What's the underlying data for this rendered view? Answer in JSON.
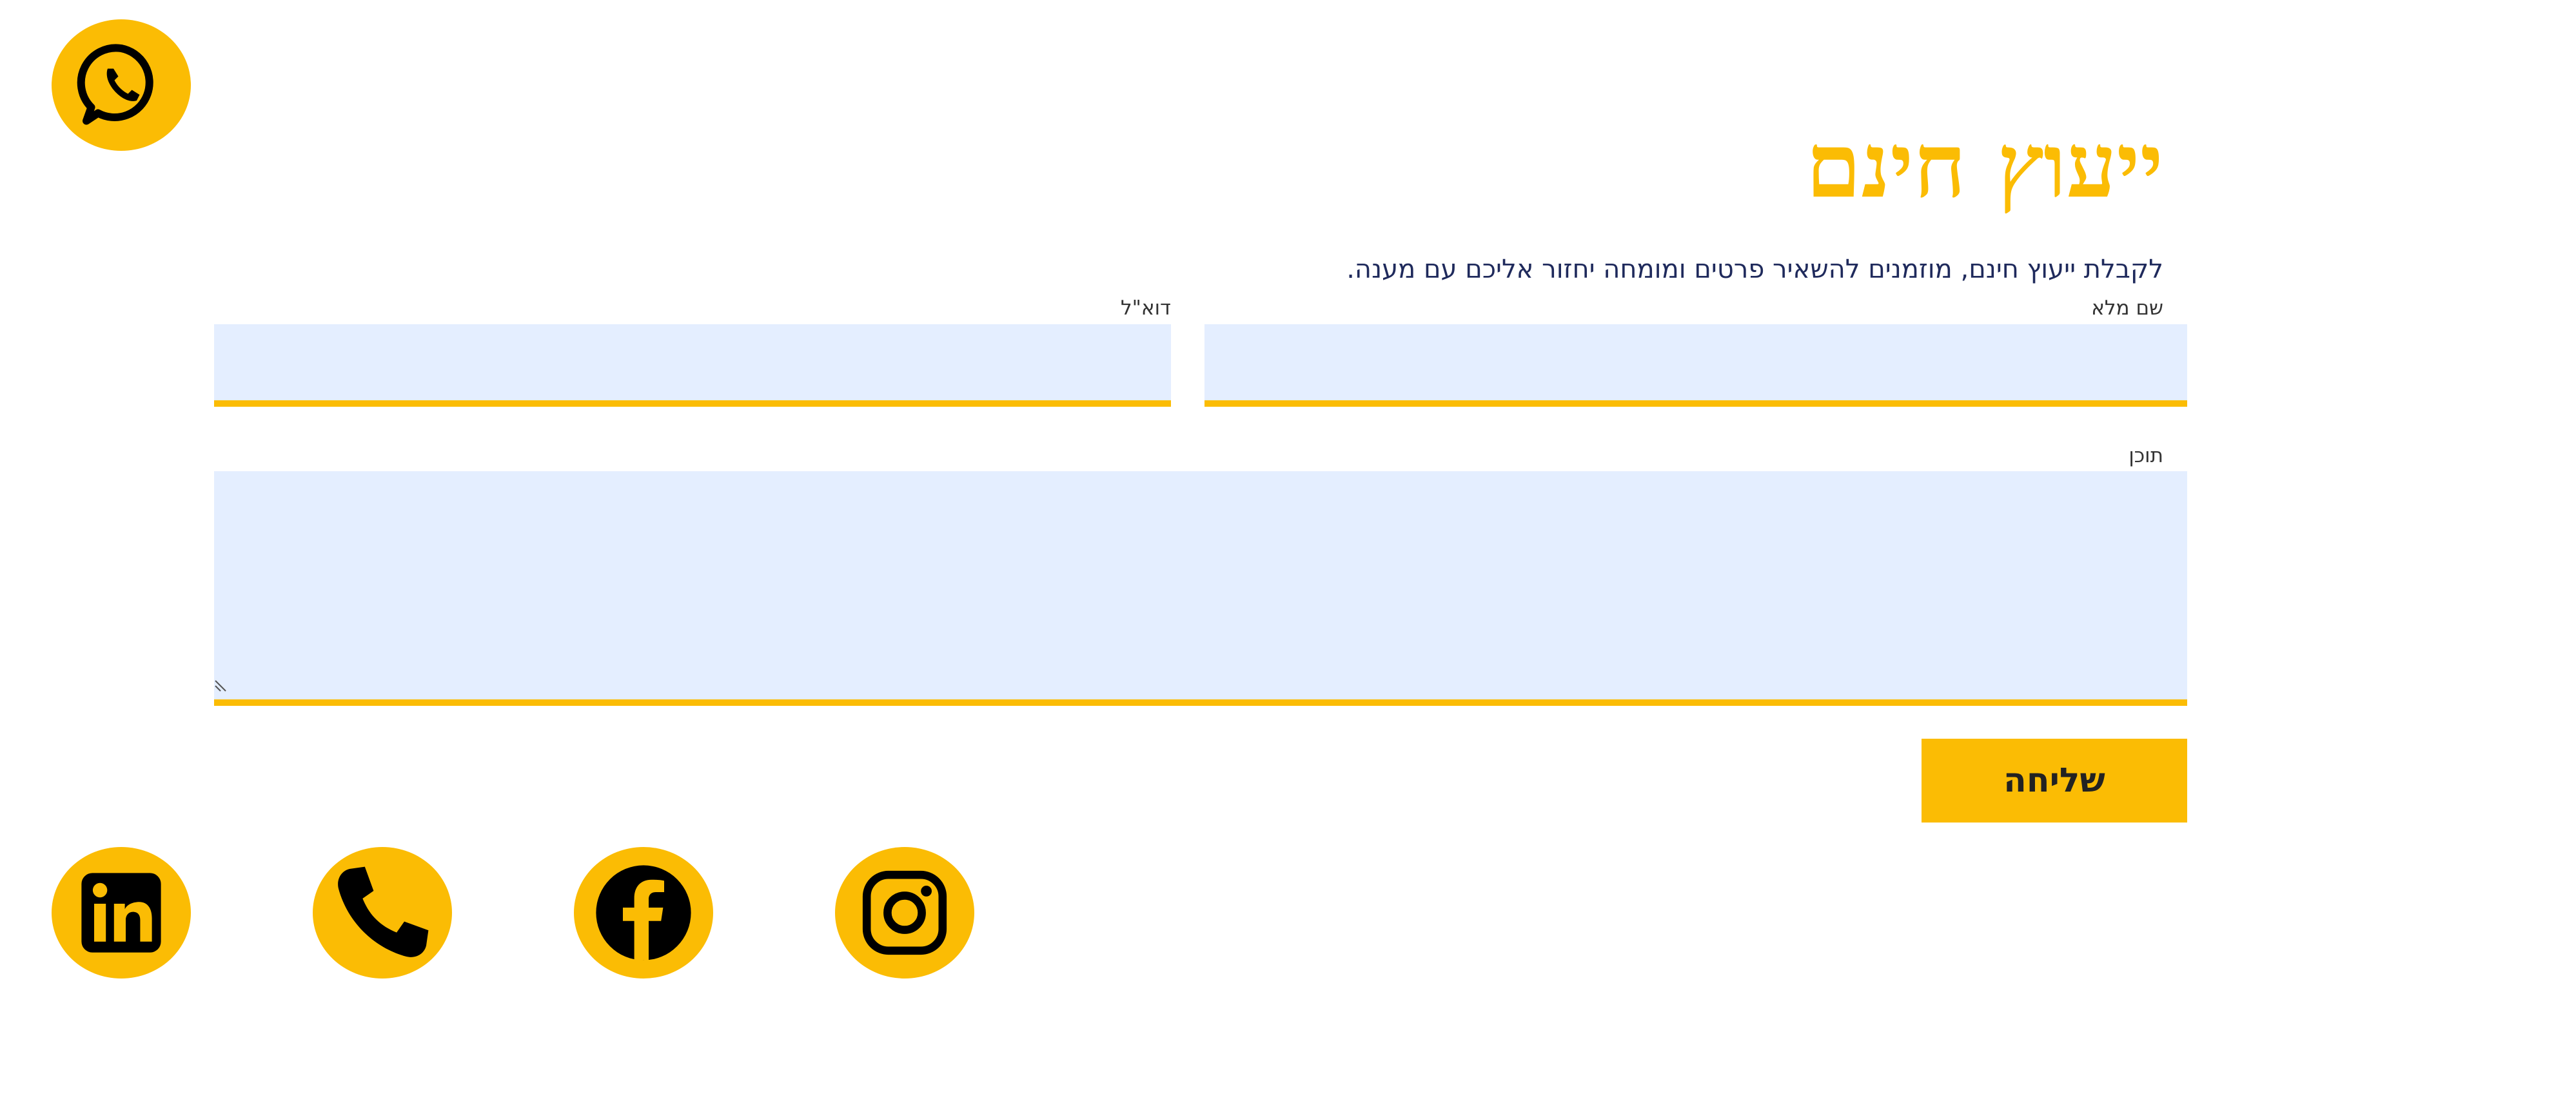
{
  "form": {
    "title": "ייעוץ חינם",
    "subtitle": "לקבלת ייעוץ חינם, מוזמנים להשאיר פרטים ומומחה יחזור אליכם עם מענה.",
    "fields": {
      "full_name": {
        "label": "שם מלא",
        "value": ""
      },
      "email": {
        "label": "דוא\"ל",
        "value": ""
      },
      "content": {
        "label": "תוכן",
        "value": ""
      }
    },
    "submit_label": "שליחה"
  },
  "icons": {
    "whatsapp": "whatsapp-icon",
    "social": [
      "linkedin-icon",
      "phone-icon",
      "facebook-icon",
      "instagram-icon"
    ]
  },
  "colors": {
    "accent": "#fbbc04",
    "field_background": "#e4eeff",
    "subtitle_text": "#1f2a5c",
    "icon_glyph": "#000000"
  }
}
